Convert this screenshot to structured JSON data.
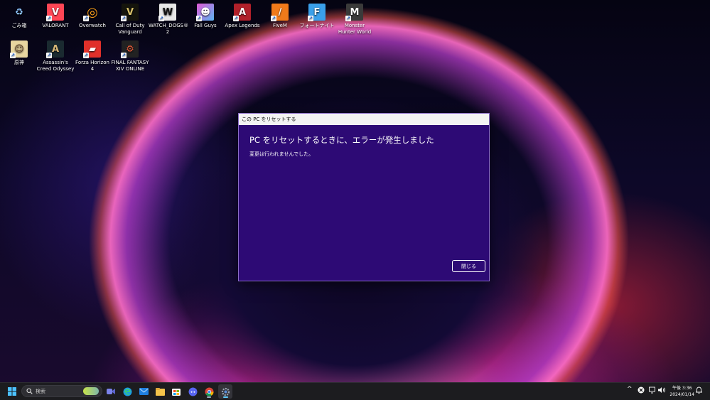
{
  "desktop": {
    "icons": [
      {
        "label": "ごみ箱",
        "color": "#3a7bd5",
        "glyph": "♻"
      },
      {
        "label": "VALORANT",
        "color": "#ff4655",
        "glyph": "V"
      },
      {
        "label": "Overwatch",
        "color": "#f99e1a",
        "glyph": "◎"
      },
      {
        "label": "Call of Duty Vanguard",
        "color": "#1a1a10",
        "glyph": "V"
      },
      {
        "label": "WATCH_DOGS® 2",
        "color": "#e8e8e8",
        "glyph": "W"
      },
      {
        "label": "Fall Guys",
        "color": "#c45ae8",
        "glyph": "☻"
      },
      {
        "label": "Apex Legends",
        "color": "#b0202a",
        "glyph": "A"
      },
      {
        "label": "FiveM",
        "color": "#f07a1a",
        "glyph": "/"
      },
      {
        "label": "フォートナイト",
        "color": "#3aa0ea",
        "glyph": "F"
      },
      {
        "label": "Monster Hunter World",
        "color": "#444444",
        "glyph": "M"
      },
      {
        "label": "原神",
        "color": "#e8d6a0",
        "glyph": "☺"
      },
      {
        "label": "Assassin's Creed Odyssey",
        "color": "#1a2a30",
        "glyph": "A"
      },
      {
        "label": "Forza Horizon 4",
        "color": "#e0302a",
        "glyph": "▰"
      },
      {
        "label": "FINAL FANTASY XIV ONLINE",
        "color": "#222222",
        "glyph": "⚙"
      }
    ]
  },
  "dialog": {
    "title": "この PC をリセットする",
    "heading": "PC をリセットするときに、エラーが発生しました",
    "message": "変更は行われませんでした。",
    "close_label": "閉じる"
  },
  "taskbar": {
    "search_placeholder": "検索",
    "apps": [
      "start-icon",
      "search-icon",
      "meet-icon",
      "edge-icon",
      "mail-icon",
      "file-explorer-icon",
      "store-icon",
      "discord-icon",
      "chrome-icon",
      "settings-icon"
    ],
    "tray": {
      "chevron": "^",
      "clock_time": "午後 3:36",
      "clock_date": "2024/01/14"
    }
  },
  "colors": {
    "dialog_bg": "#2d0a75",
    "taskbar_bg": "#1c1c1f",
    "accent": "#0078d4"
  }
}
